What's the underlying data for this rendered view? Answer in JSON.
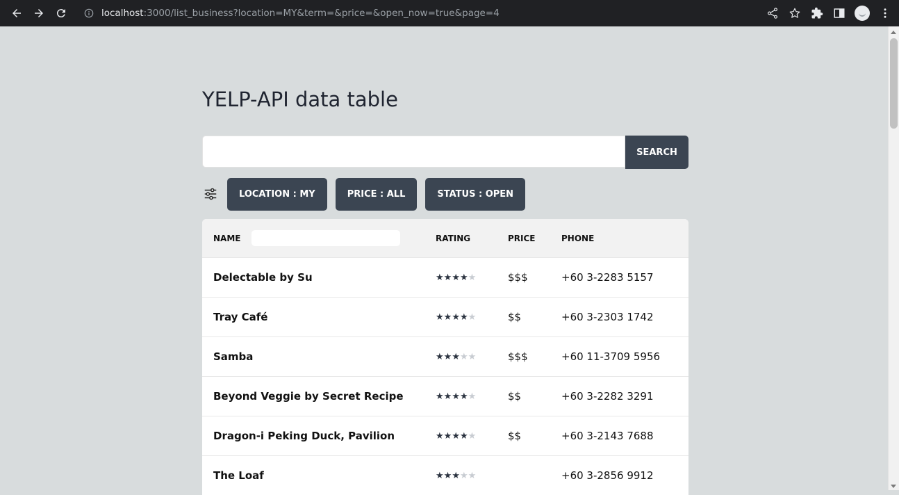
{
  "browser": {
    "url_host": "localhost",
    "url_path": ":3000/list_business?location=MY&term=&price=&open_now=true&page=4"
  },
  "page": {
    "title": "YELP-API data table",
    "search": {
      "value": "",
      "button_label": "SEARCH"
    },
    "filters": {
      "location": "LOCATION : MY",
      "price": "PRICE : ALL",
      "status": "STATUS : OPEN"
    },
    "table": {
      "headers": {
        "name": "NAME",
        "rating": "RATING",
        "price": "PRICE",
        "phone": "PHONE"
      },
      "name_filter_value": "",
      "rows": [
        {
          "name": "Delectable by Su",
          "rating": 4,
          "price": "$$$",
          "phone": "+60 3-2283 5157"
        },
        {
          "name": "Tray Café",
          "rating": 4,
          "price": "$$",
          "phone": "+60 3-2303 1742"
        },
        {
          "name": "Samba",
          "rating": 3,
          "price": "$$$",
          "phone": "+60 11-3709 5956"
        },
        {
          "name": "Beyond Veggie by Secret Recipe",
          "rating": 4,
          "price": "$$",
          "phone": "+60 3-2282 3291"
        },
        {
          "name": "Dragon-i Peking Duck, Pavilion",
          "rating": 4,
          "price": "$$",
          "phone": "+60 3-2143 7688"
        },
        {
          "name": "The Loaf",
          "rating": 3,
          "price": "",
          "phone": "+60 3-2856 9912"
        }
      ]
    }
  },
  "colors": {
    "button_bg": "#3b4552",
    "page_bg": "#d8dcdd",
    "star_on": "#2b3340",
    "star_off": "#c8ccd2"
  },
  "icons": [
    "back-icon",
    "forward-icon",
    "reload-icon",
    "info-icon",
    "share-icon",
    "star-bookmark-icon",
    "extensions-icon",
    "sidepanel-icon",
    "profile-avatar",
    "more-icon",
    "filter-sliders-icon"
  ]
}
